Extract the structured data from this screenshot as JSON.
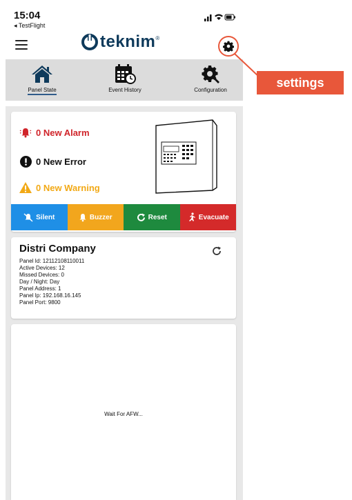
{
  "status_bar": {
    "time": "15:04",
    "back_label": "◂ TestFlight"
  },
  "header": {
    "logo_text": "teknim",
    "logo_mark": "®"
  },
  "callout": {
    "label": "settings",
    "color": "#e8573a"
  },
  "tabs": [
    {
      "label": "Panel State",
      "icon": "home-icon",
      "active": true
    },
    {
      "label": "Event History",
      "icon": "calendar-icon",
      "active": false
    },
    {
      "label": "Configuration",
      "icon": "gear-wrench-icon",
      "active": false
    }
  ],
  "status": {
    "alarm": "0 New Alarm",
    "error": "0 New Error",
    "warning": "0 New Warning"
  },
  "actions": {
    "silent": "Silent",
    "buzzer": "Buzzer",
    "reset": "Reset",
    "evacuate": "Evacuate"
  },
  "panel": {
    "company": "Distri Company",
    "lines": [
      "Panel Id: 12112108110011",
      "Active Devices: 12",
      "Missed Devices: 0",
      "Day / Night: Day",
      "Panel Address: 1",
      "Panel Ip: 192.168.16.145",
      "Panel Port: 9800"
    ]
  },
  "wait_text": "Wait For AFW...",
  "colors": {
    "alarm": "#d0242a",
    "warning": "#f2a916",
    "silent": "#1f8fe6",
    "buzzer": "#f2a61d",
    "reset": "#1e8a3e",
    "evacuate": "#d42a2a",
    "brand": "#0e3a5b"
  }
}
